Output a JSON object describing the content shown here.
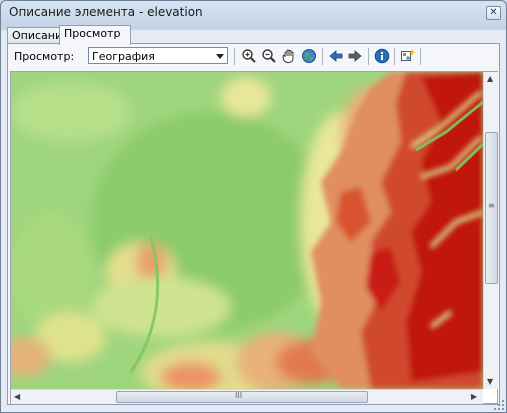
{
  "window": {
    "title": "Описание элемента - elevation",
    "close_symbol": "✕"
  },
  "tabs": [
    {
      "label": "Описание",
      "active": false
    },
    {
      "label": "Просмотр",
      "active": true
    }
  ],
  "toolbar": {
    "view_label": "Просмотр:",
    "view_select": {
      "value": "География"
    },
    "buttons": [
      "zoom-in-icon",
      "zoom-out-icon",
      "pan-hand-icon",
      "globe-icon",
      "back-arrow-icon",
      "forward-arrow-icon",
      "info-icon",
      "create-thumbnail-icon"
    ]
  },
  "scrollbars": {
    "grip": "≡",
    "hgrip": "III"
  },
  "colors": {
    "low": "#8ed06a",
    "mid": "#e9e58f",
    "high": "#e88b5c",
    "peak": "#c3160e",
    "accent": "#2a6db5"
  }
}
